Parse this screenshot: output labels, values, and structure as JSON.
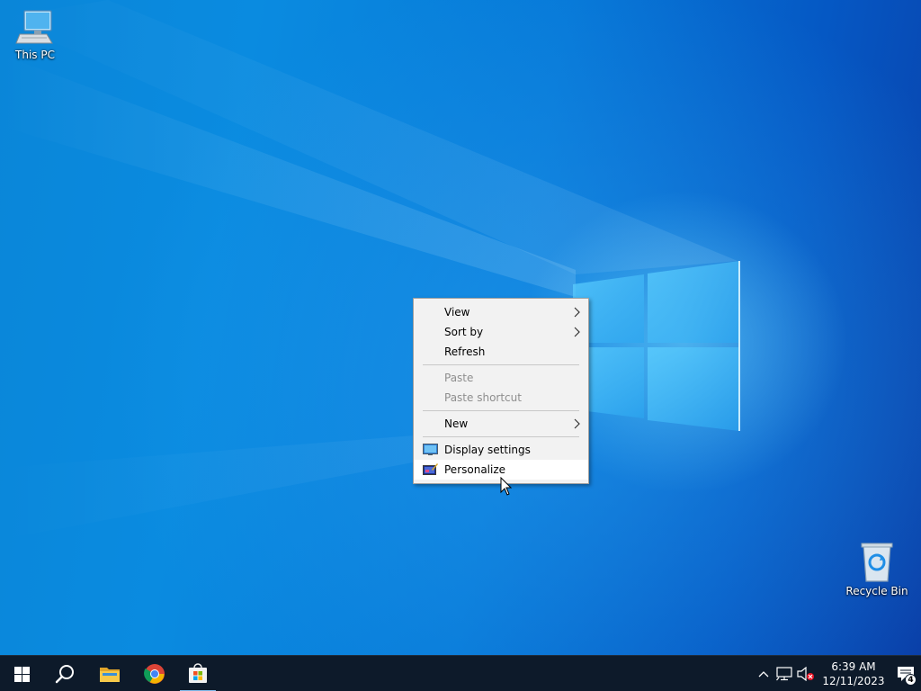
{
  "desktop": {
    "icons": [
      {
        "label": "This PC",
        "icon": "this-pc-icon"
      },
      {
        "label": "Recycle Bin",
        "icon": "recycle-bin-icon"
      }
    ]
  },
  "context_menu": {
    "items": [
      {
        "label": "View",
        "has_submenu": true,
        "enabled": true
      },
      {
        "label": "Sort by",
        "has_submenu": true,
        "enabled": true
      },
      {
        "label": "Refresh",
        "has_submenu": false,
        "enabled": true
      },
      {
        "label": "Paste",
        "has_submenu": false,
        "enabled": false
      },
      {
        "label": "Paste shortcut",
        "has_submenu": false,
        "enabled": false
      },
      {
        "label": "New",
        "has_submenu": true,
        "enabled": true
      },
      {
        "label": "Display settings",
        "icon": "display-settings-icon",
        "enabled": true
      },
      {
        "label": "Personalize",
        "icon": "personalize-icon",
        "enabled": true,
        "hovered": true
      }
    ]
  },
  "taskbar": {
    "pinned": [
      {
        "name": "Start",
        "icon": "windows-logo-icon"
      },
      {
        "name": "Search",
        "icon": "search-icon"
      },
      {
        "name": "File Explorer",
        "icon": "folder-icon"
      },
      {
        "name": "Google Chrome",
        "icon": "chrome-icon"
      },
      {
        "name": "Microsoft Store",
        "icon": "store-icon",
        "active": true
      }
    ],
    "tray": {
      "time": "6:39 AM",
      "date": "12/11/2023",
      "notification_count": "4",
      "volume_muted": true
    }
  },
  "colors": {
    "wallpaper_accent": "#0a86d8",
    "taskbar_bg": "#0d1a2a",
    "menu_bg": "#f2f2f2",
    "active_indicator": "#7fb8e8"
  }
}
